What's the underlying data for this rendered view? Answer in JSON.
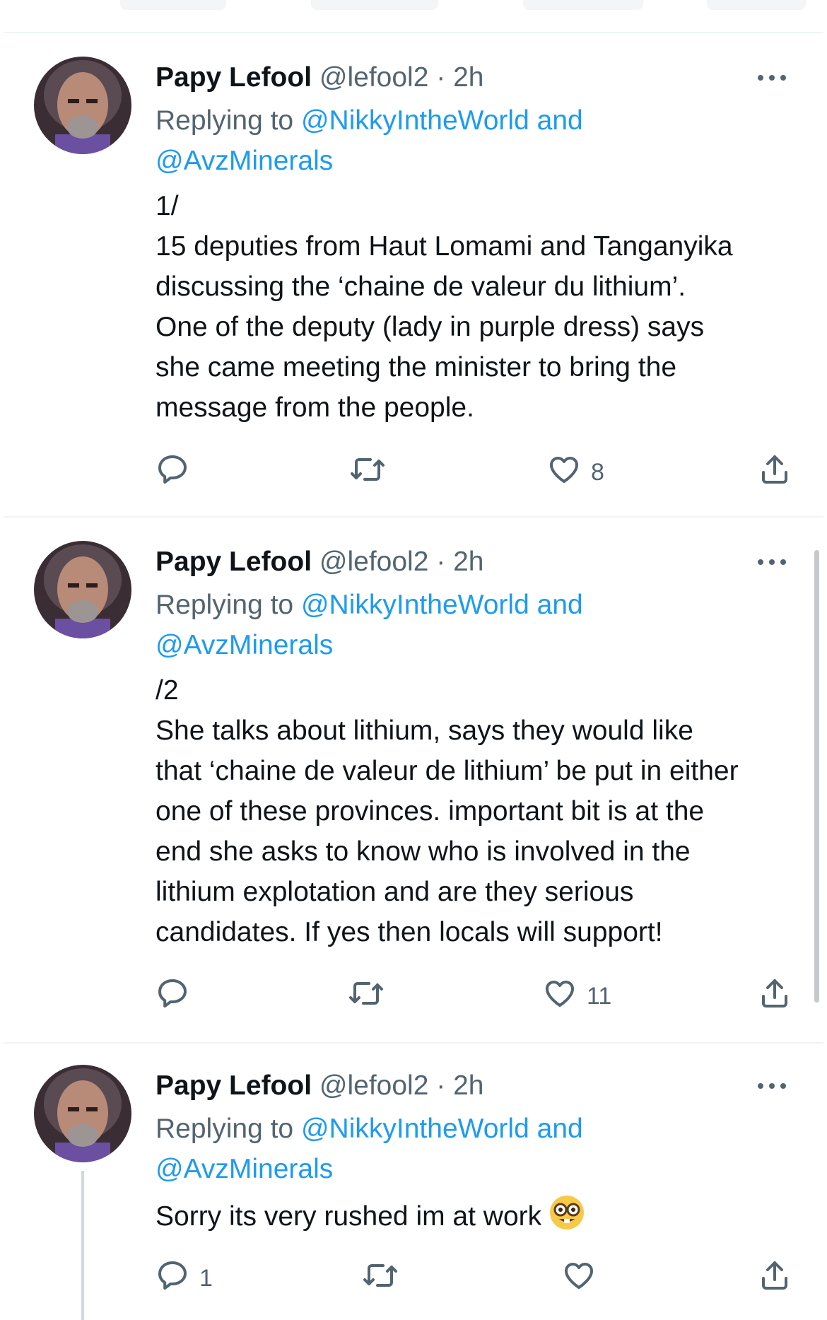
{
  "tweets": [
    {
      "author_name": "Papy Lefool",
      "handle": "@lefool2",
      "separator": "·",
      "time": "2h",
      "replying_prefix": "Replying to",
      "replying_mention_1": "@NikkyIntheWorld",
      "replying_and": "and",
      "replying_mention_2": "@AvzMinerals",
      "lines": [
        "1/",
        "15 deputies from Haut Lomami and Tanganyika",
        "discussing the ‘chaine de valeur du lithium’.",
        "One of the deputy (lady in purple dress) says",
        "she came meeting the minister to bring the",
        "message from the people."
      ],
      "reply_count": "",
      "retweet_count": "",
      "like_count": "8"
    },
    {
      "author_name": "Papy Lefool",
      "handle": "@lefool2",
      "separator": "·",
      "time": "2h",
      "replying_prefix": "Replying to",
      "replying_mention_1": "@NikkyIntheWorld",
      "replying_and": "and",
      "replying_mention_2": "@AvzMinerals",
      "lines": [
        "/2",
        "She talks about lithium, says they would like",
        "that ‘chaine de valeur de lithium’ be put in either",
        "one of these provinces. important bit is at the",
        "end she asks to know who is involved in the",
        "lithium explotation and are they serious",
        "candidates. If yes then locals will support!"
      ],
      "reply_count": "",
      "retweet_count": "",
      "like_count": "11"
    },
    {
      "author_name": "Papy Lefool",
      "handle": "@lefool2",
      "separator": "·",
      "time": "2h",
      "replying_prefix": "Replying to",
      "replying_mention_1": "@NikkyIntheWorld",
      "replying_and": "and",
      "replying_mention_2": "@AvzMinerals",
      "lines": [
        "Sorry its very rushed im at work"
      ],
      "emoji": "nerd-face-emoji",
      "reply_count": "1",
      "retweet_count": "",
      "like_count": ""
    }
  ],
  "icons": {
    "reply": "speech-bubble-icon",
    "retweet": "retweet-arrows-icon",
    "like": "heart-icon",
    "share": "share-upload-icon",
    "more": "more-dots-icon"
  },
  "colors": {
    "text": "#0f1419",
    "secondary": "#536471",
    "link": "#1d9bf0",
    "divider": "#eff3f4"
  }
}
